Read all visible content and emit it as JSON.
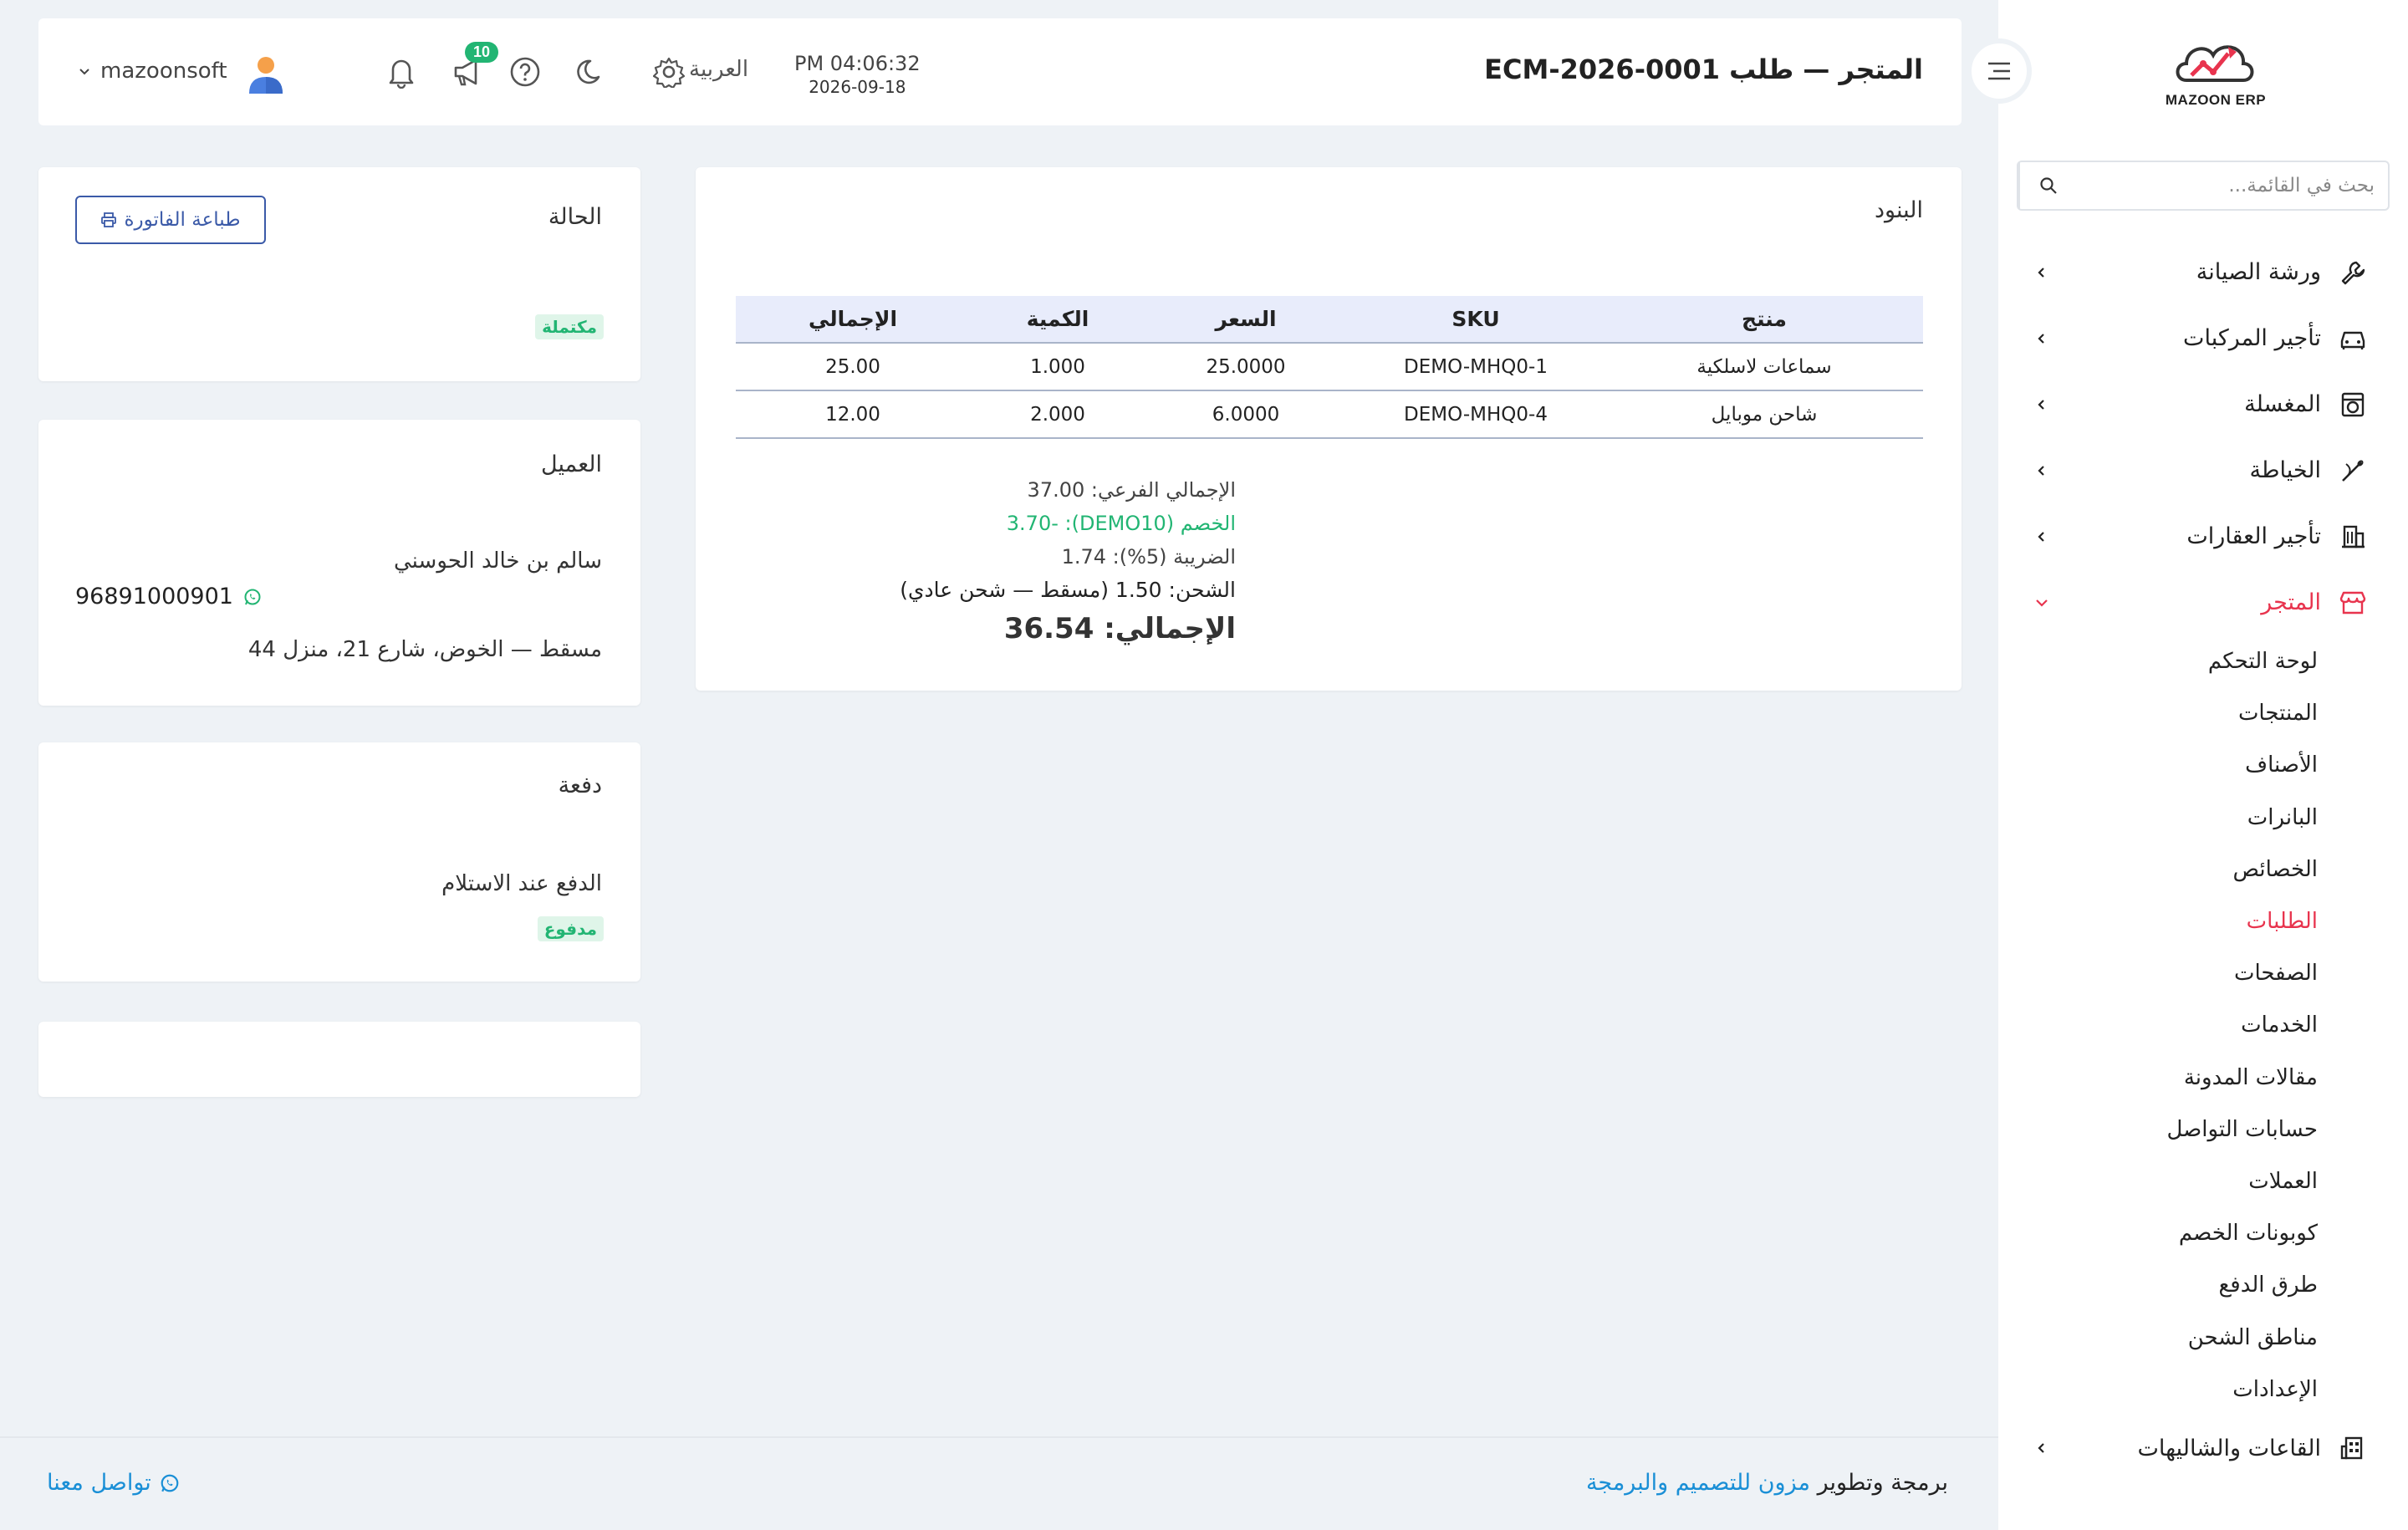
{
  "brand": {
    "logo_text": "MAZOON ERP",
    "accent": "#e8344e",
    "green": "#22b573",
    "link": "#1a8fd6"
  },
  "sidebar": {
    "search_placeholder": "بحث في القائمة...",
    "items": [
      {
        "label": "ورشة الصيانة",
        "icon": "wrench-icon"
      },
      {
        "label": "تأجير المركبات",
        "icon": "car-icon"
      },
      {
        "label": "المغسلة",
        "icon": "washer-icon"
      },
      {
        "label": "الخياطة",
        "icon": "needle-icon"
      },
      {
        "label": "تأجير العقارات",
        "icon": "building-icon"
      },
      {
        "label": "المتجر",
        "icon": "store-icon",
        "active": true
      },
      {
        "label": "القاعات والشاليهات",
        "icon": "hall-icon"
      }
    ],
    "store_submenu": [
      "لوحة التحكم",
      "المنتجات",
      "الأصناف",
      "البانرات",
      "الخصائص",
      "الطلبات",
      "الصفحات",
      "الخدمات",
      "مقالات المدونة",
      "حسابات التواصل",
      "العملات",
      "كوبونات الخصم",
      "طرق الدفع",
      "مناطق الشحن",
      "الإعدادات"
    ],
    "active_sub": "الطلبات"
  },
  "header": {
    "title": "المتجر — طلب ECM-2026-0001",
    "time": "PM 04:06:32",
    "date": "2026-09-18",
    "language": "العربية",
    "notifications_count": "10",
    "username": "mazoonsoft"
  },
  "items_card": {
    "title": "البنود",
    "columns": [
      "منتج",
      "SKU",
      "السعر",
      "الكمية",
      "الإجمالي"
    ],
    "rows": [
      [
        "سماعات لاسلكية",
        "DEMO-MHQ0-1",
        "25.0000",
        "1.000",
        "25.00"
      ],
      [
        "شاحن موبايل",
        "DEMO-MHQ0-4",
        "6.0000",
        "2.000",
        "12.00"
      ]
    ],
    "subtotal": "الإجمالي الفرعي: 37.00",
    "discount": "الخصم (DEMO10): -3.70",
    "tax": "الضريبة (5%): 1.74",
    "shipping": "الشحن: 1.50 (مسقط — شحن عادي)",
    "grand_total": "الإجمالي: 36.54"
  },
  "status_card": {
    "title": "الحالة",
    "print_label": "طباعة الفاتورة",
    "status": "مكتملة"
  },
  "customer_card": {
    "title": "العميل",
    "name": "سالم بن خالد الحوسني",
    "phone": "96891000901",
    "address": "مسقط — الخوض، شارع 21، منزل 44"
  },
  "payment_card": {
    "title": "دفعة",
    "method": "الدفع عند الاستلام",
    "status": "مدفوع"
  },
  "footer": {
    "credit_prefix": "برمجة وتطوير",
    "credit_link": "مزون للتصميم والبرمجة",
    "contact": "تواصل معنا"
  }
}
